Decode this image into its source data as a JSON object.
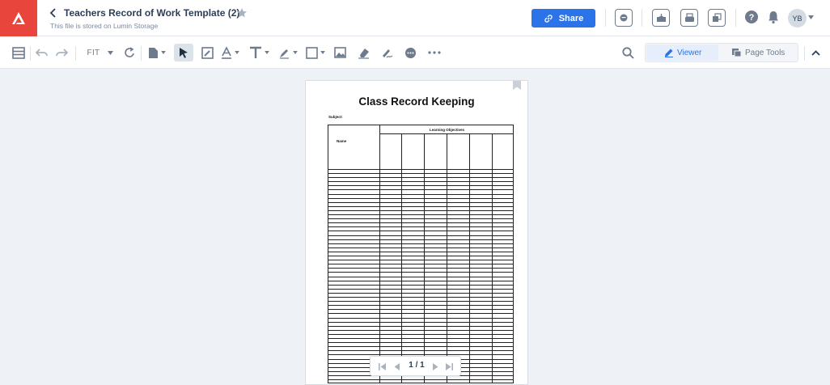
{
  "app": {
    "name": "Lumin",
    "brand_color": "#e8453c",
    "accent_color": "#2a73e8"
  },
  "header": {
    "title": "Teachers Record of Work Template (2)",
    "storage_note": "This file is stored on Lumin Storage",
    "share_label": "Share",
    "avatar_initials": "YB"
  },
  "toolbar": {
    "zoom_label": "FIT",
    "modes": [
      {
        "label": "Viewer",
        "active": true
      },
      {
        "label": "Page Tools",
        "active": false
      }
    ]
  },
  "document": {
    "title": "Class Record Keeping",
    "subject_label": "Subject:",
    "table_header": "Learning Objectives",
    "name_column": "Name"
  },
  "pager": {
    "page_indicator": "1 / 1"
  }
}
